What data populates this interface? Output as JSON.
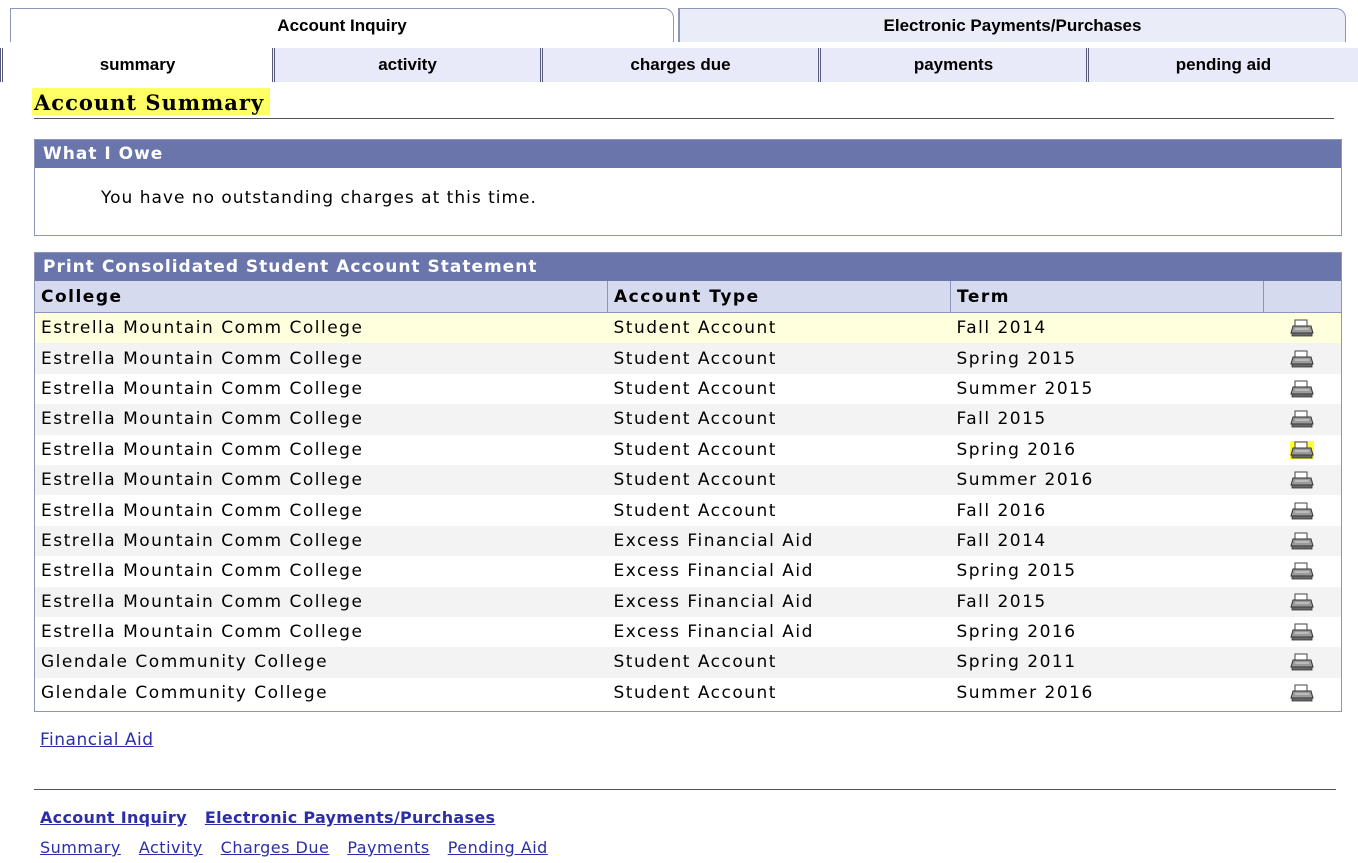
{
  "top_tabs": [
    "Account Inquiry",
    "Electronic Payments/Purchases"
  ],
  "sub_tabs": [
    "summary",
    "activity",
    "charges due",
    "payments",
    "pending aid"
  ],
  "page_title": "Account Summary",
  "what_i_owe": {
    "header": "What I Owe",
    "message": "You have no outstanding charges at this time."
  },
  "statement": {
    "header": "Print Consolidated Student Account Statement",
    "columns": [
      "College",
      "Account Type",
      "Term"
    ],
    "rows": [
      {
        "college": "Estrella Mountain Comm College",
        "account_type": "Student Account",
        "term": "Fall 2014"
      },
      {
        "college": "Estrella Mountain Comm College",
        "account_type": "Student Account",
        "term": "Spring 2015"
      },
      {
        "college": "Estrella Mountain Comm College",
        "account_type": "Student Account",
        "term": "Summer 2015"
      },
      {
        "college": "Estrella Mountain Comm College",
        "account_type": "Student Account",
        "term": "Fall 2015"
      },
      {
        "college": "Estrella Mountain Comm College",
        "account_type": "Student Account",
        "term": "Spring 2016"
      },
      {
        "college": "Estrella Mountain Comm College",
        "account_type": "Student Account",
        "term": "Summer 2016"
      },
      {
        "college": "Estrella Mountain Comm College",
        "account_type": "Student Account",
        "term": "Fall 2016"
      },
      {
        "college": "Estrella Mountain Comm College",
        "account_type": "Excess Financial Aid",
        "term": "Fall 2014"
      },
      {
        "college": "Estrella Mountain Comm College",
        "account_type": "Excess Financial Aid",
        "term": "Spring 2015"
      },
      {
        "college": "Estrella Mountain Comm College",
        "account_type": "Excess Financial Aid",
        "term": "Fall 2015"
      },
      {
        "college": "Estrella Mountain Comm College",
        "account_type": "Excess Financial Aid",
        "term": "Spring 2016"
      },
      {
        "college": "Glendale Community College",
        "account_type": "Student Account",
        "term": "Spring 2011"
      },
      {
        "college": "Glendale Community College",
        "account_type": "Student Account",
        "term": "Summer 2016"
      }
    ],
    "row_icon": "printer-icon"
  },
  "financial_aid_link": "Financial Aid",
  "footer_links_main": [
    "Account Inquiry",
    "Electronic Payments/Purchases"
  ],
  "footer_links_sub": [
    "Summary",
    "Activity",
    "Charges Due",
    "Payments",
    "Pending Aid"
  ],
  "colors": {
    "header_bar": "#6a76ab",
    "column_header": "#d5daef",
    "highlight": "#ffff66",
    "link": "#2b2ea8"
  }
}
